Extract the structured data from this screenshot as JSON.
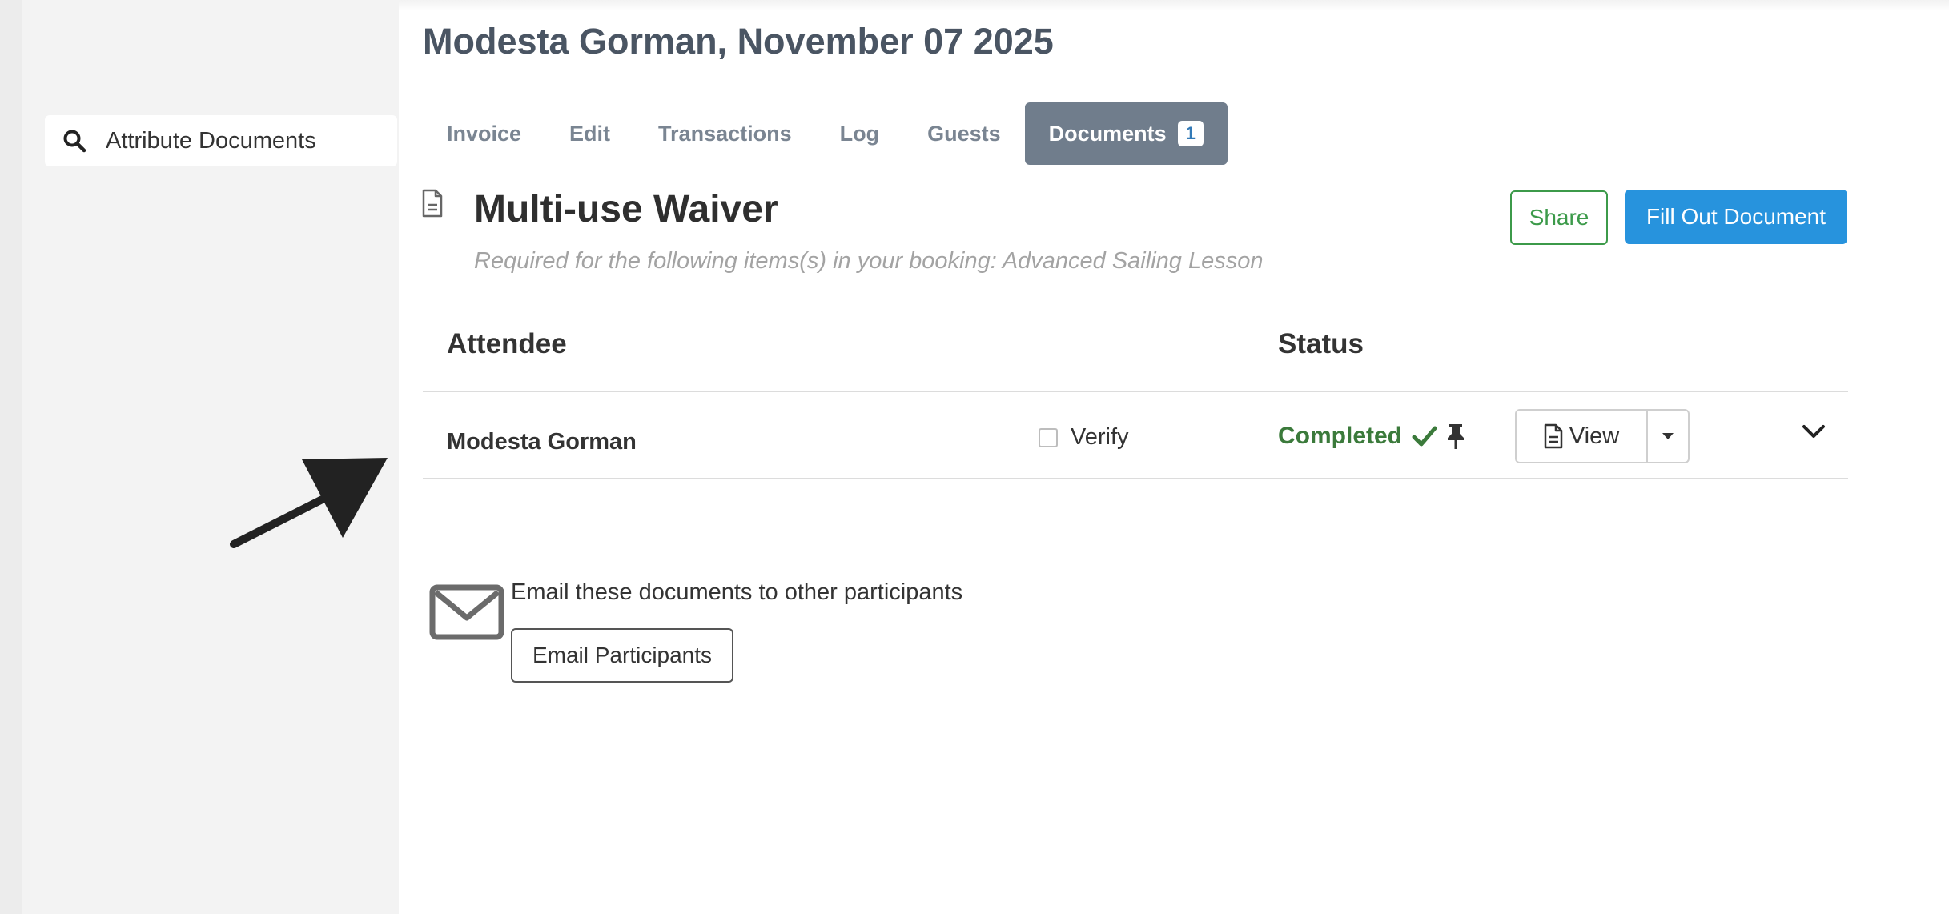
{
  "sidebar": {
    "search": {
      "label": "Attribute Documents",
      "icon": "search-icon"
    }
  },
  "header": {
    "title": "Modesta Gorman, November 07 2025"
  },
  "tabs": [
    {
      "label": "Invoice"
    },
    {
      "label": "Edit"
    },
    {
      "label": "Transactions"
    },
    {
      "label": "Log"
    },
    {
      "label": "Guests"
    },
    {
      "label": "Documents",
      "badge": "1",
      "active": true
    }
  ],
  "document": {
    "icon": "file-icon",
    "title": "Multi-use Waiver",
    "subtitle": "Required for the following items(s) in your booking: Advanced Sailing Lesson",
    "share_label": "Share",
    "fill_label": "Fill Out Document"
  },
  "table": {
    "headers": {
      "attendee": "Attendee",
      "status": "Status"
    },
    "rows": [
      {
        "name": "Modesta Gorman",
        "verify_label": "Verify",
        "status": "Completed",
        "view_label": "View"
      }
    ]
  },
  "email": {
    "text": "Email these documents to other participants",
    "button_label": "Email Participants",
    "icon": "envelope-icon"
  },
  "colors": {
    "accent": "#2793dd",
    "success": "#3b7a3b",
    "tab_active": "#707d8c",
    "title": "#4a5563"
  }
}
